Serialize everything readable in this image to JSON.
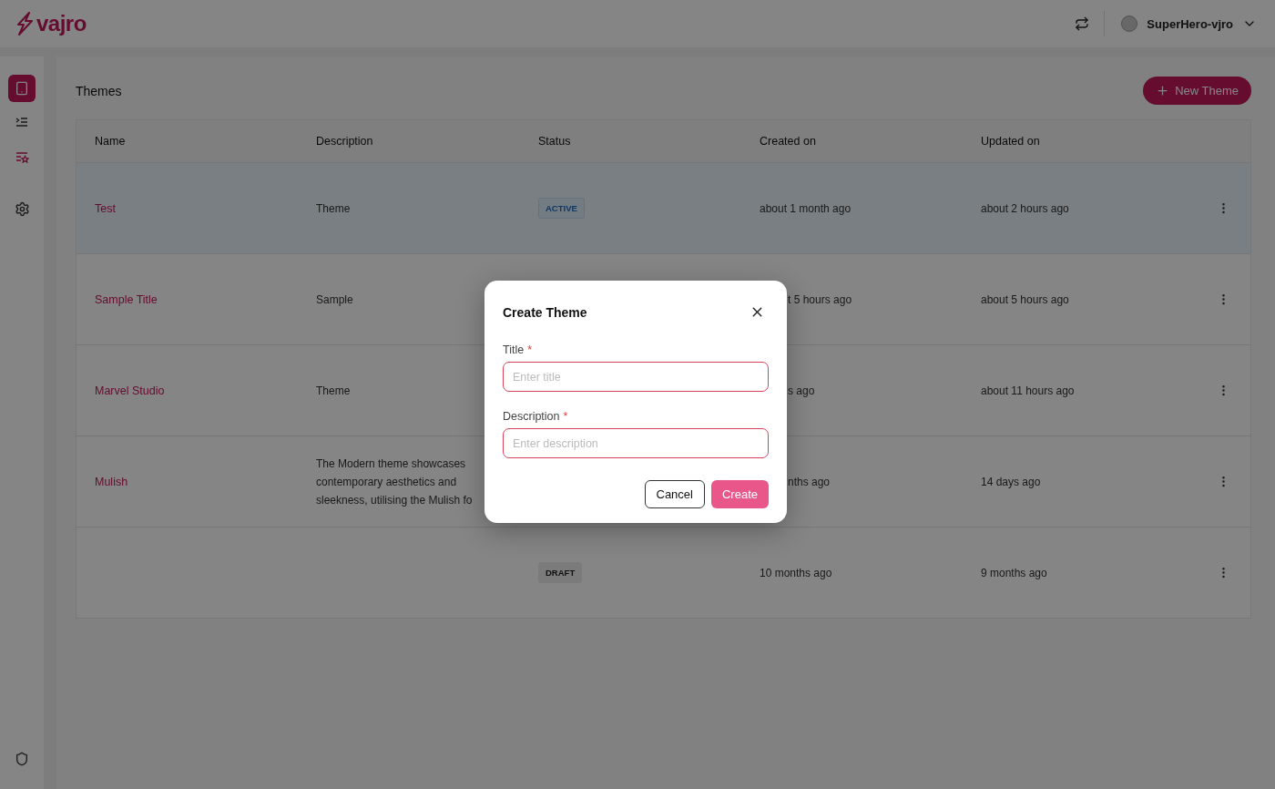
{
  "header": {
    "logo": "vajro",
    "user": "SuperHero-vjro"
  },
  "sidebar": {
    "items": [
      {
        "selected": true
      },
      {
        "selected": false
      },
      {
        "selected": false
      },
      {
        "selected": false
      }
    ]
  },
  "page": {
    "title": "Themes",
    "new_button": "New Theme"
  },
  "table": {
    "columns": [
      "Name",
      "Description",
      "Status",
      "Created on",
      "Updated on"
    ],
    "rows": [
      {
        "selected": true,
        "name": "Test",
        "description": "Theme",
        "status": {
          "label": "ACTIVE",
          "kind": "active"
        },
        "created": {
          "text": "about 1 month ago",
          "cut": false
        },
        "updated": "about 2 hours ago"
      },
      {
        "selected": false,
        "name": "Sample Title",
        "description": "Sample",
        "created": {
          "text": "t 5 hours ago",
          "cut": true
        },
        "updated": "about 5 hours ago"
      },
      {
        "selected": false,
        "name": "Marvel Studio",
        "description": "Theme",
        "created": {
          "text": "s ago",
          "cut": true
        },
        "updated": "about 11 hours ago"
      },
      {
        "selected": false,
        "name": "Mulish",
        "description": "The Modern theme showcases contemporary aesthetics and sleekness, utilising the Mulish fo",
        "created": {
          "text": "nths ago",
          "cut": true
        },
        "updated": "14 days ago"
      },
      {
        "selected": false,
        "name": "",
        "description": "",
        "status": {
          "label": "DRAFT",
          "kind": "draft"
        },
        "created": {
          "text": "10 months ago",
          "cut": false
        },
        "updated": "9 months ago"
      }
    ]
  },
  "modal": {
    "title": "Create Theme",
    "fields": [
      {
        "label": "Title",
        "required_mark": "*",
        "placeholder": "Enter title"
      },
      {
        "label": "Description",
        "required_mark": "*",
        "placeholder": "Enter description"
      }
    ],
    "cancel": "Cancel",
    "create": "Create"
  }
}
